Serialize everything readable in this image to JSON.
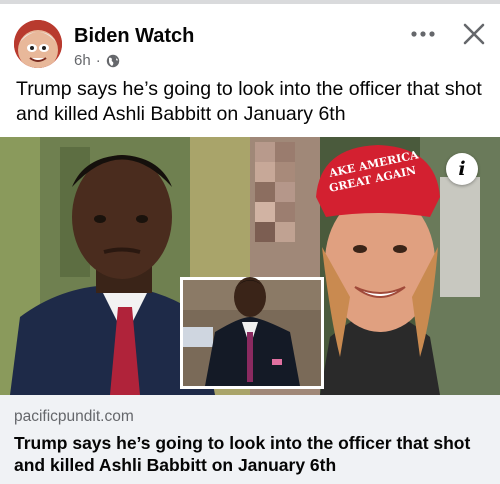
{
  "post": {
    "page_name": "Biden Watch",
    "time": "6h",
    "separator": "·",
    "audience_icon": "globe-icon",
    "text": "Trump says he’s going to look into the officer that shot and killed Ashli Babbitt on January 6th"
  },
  "image": {
    "hat_text_line1": "AKE AMERICA",
    "hat_text_line2": "GREAT AGAIN",
    "info_label": "i"
  },
  "link_preview": {
    "domain": "pacificpundit.com",
    "title": "Trump says he’s going to look into the officer that shot and killed Ashli Babbitt on January 6th"
  },
  "icons": {
    "more": "more-dots-icon",
    "close": "close-icon",
    "info": "info-icon"
  },
  "colors": {
    "text": "#050505",
    "secondary": "#65676b",
    "preview_bg": "#f0f2f5",
    "hat_red": "#d32030"
  }
}
